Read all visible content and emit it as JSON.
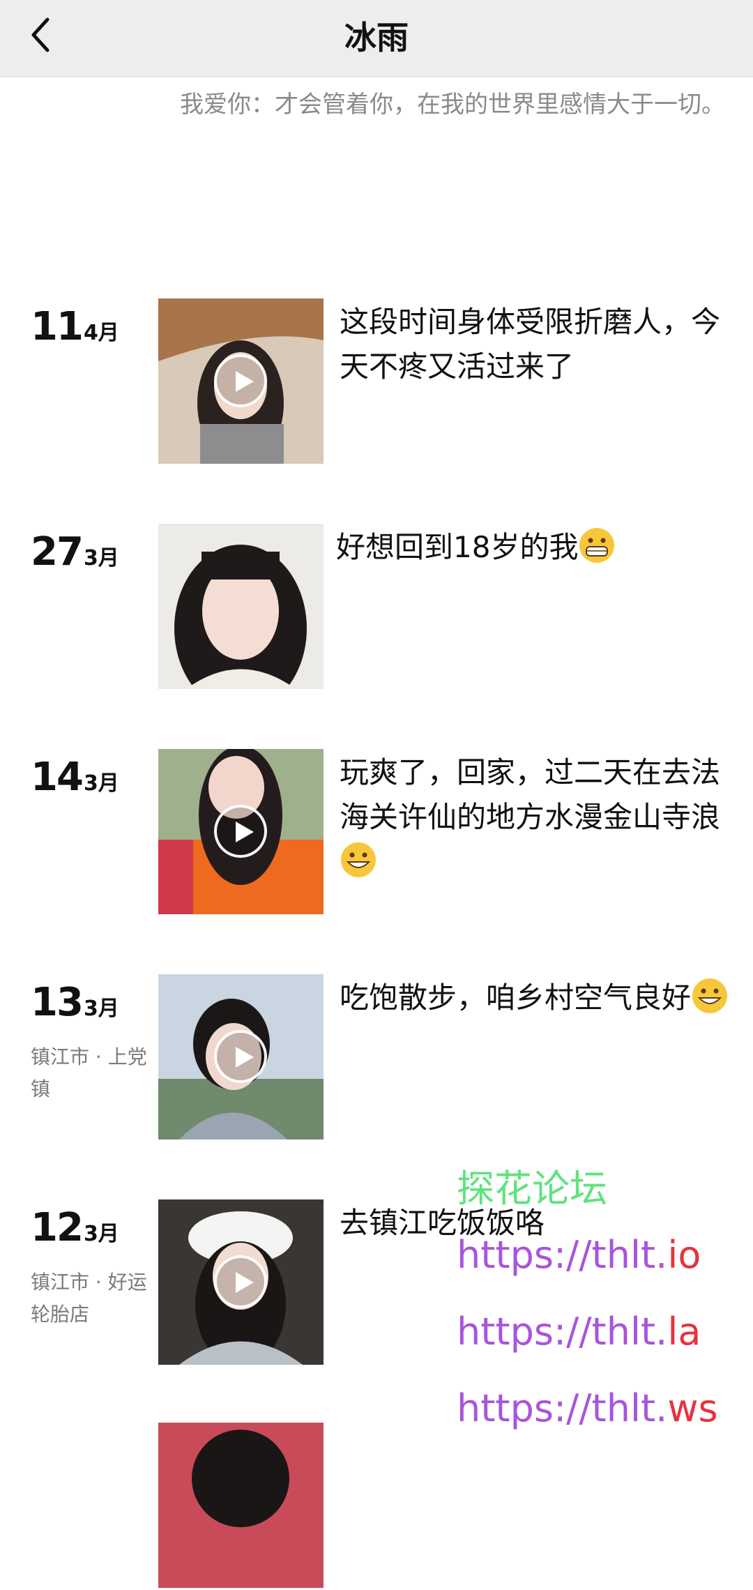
{
  "header": {
    "title": "冰雨",
    "back_icon": "chevron-left-icon"
  },
  "profile": {
    "signature": "我爱你：才会管着你，在我的世界里感情大于一切。"
  },
  "posts": [
    {
      "day": "11",
      "month": "4月",
      "location": "",
      "media": "video",
      "text": "这段时间身体受限折磨人，今天不疼又活过来了",
      "emoji": ""
    },
    {
      "day": "27",
      "month": "3月",
      "location": "",
      "media": "photo",
      "text": "好想回到18岁的我",
      "emoji": "grinning-face-icon"
    },
    {
      "day": "14",
      "month": "3月",
      "location": "",
      "media": "video",
      "text": "玩爽了，回家，过二天在去法海关许仙的地方水漫金山寺浪",
      "emoji": "grinning-face-icon"
    },
    {
      "day": "13",
      "month": "3月",
      "location": "镇江市 · 上党镇",
      "media": "video",
      "text": "吃饱散步，咱乡村空气良好",
      "emoji": "grinning-face-icon"
    },
    {
      "day": "12",
      "month": "3月",
      "location": "镇江市 · 好运轮胎店",
      "media": "video",
      "text": "去镇江吃饭饭咯",
      "emoji": ""
    },
    {
      "day": "",
      "month": "",
      "location": "",
      "media": "photo",
      "text": "",
      "emoji": ""
    }
  ],
  "watermark": {
    "name": "探花论坛",
    "urls": [
      {
        "prefix": "https://thlt.",
        "suffix": "io"
      },
      {
        "prefix": "https://thlt.",
        "suffix": "la"
      },
      {
        "prefix": "https://thlt.",
        "suffix": "ws"
      }
    ]
  },
  "colors": {
    "header_bg": "#ededed",
    "watermark_green": "#5fe37f",
    "watermark_purple": "#a855dc",
    "watermark_red": "#e8323c"
  }
}
